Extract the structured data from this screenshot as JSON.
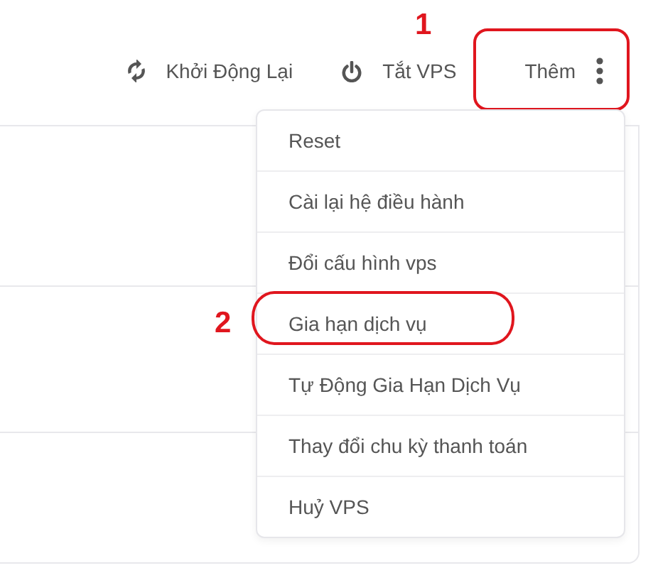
{
  "toolbar": [
    {
      "kind": "restart",
      "label": "Khởi Động Lại"
    },
    {
      "kind": "power",
      "label": "Tắt VPS"
    },
    {
      "kind": "more",
      "label": "Thêm",
      "annotation": "1"
    }
  ],
  "menu": {
    "open": true,
    "items": [
      {
        "label": "Reset"
      },
      {
        "label": "Cài lại hệ điều hành"
      },
      {
        "label": "Đổi cấu hình vps"
      },
      {
        "label": "Gia hạn dịch vụ",
        "annotation": "2"
      },
      {
        "label": "Tự Động Gia Hạn Dịch Vụ"
      },
      {
        "label": "Thay đổi chu kỳ thanh toán"
      },
      {
        "label": "Huỷ VPS"
      }
    ]
  }
}
